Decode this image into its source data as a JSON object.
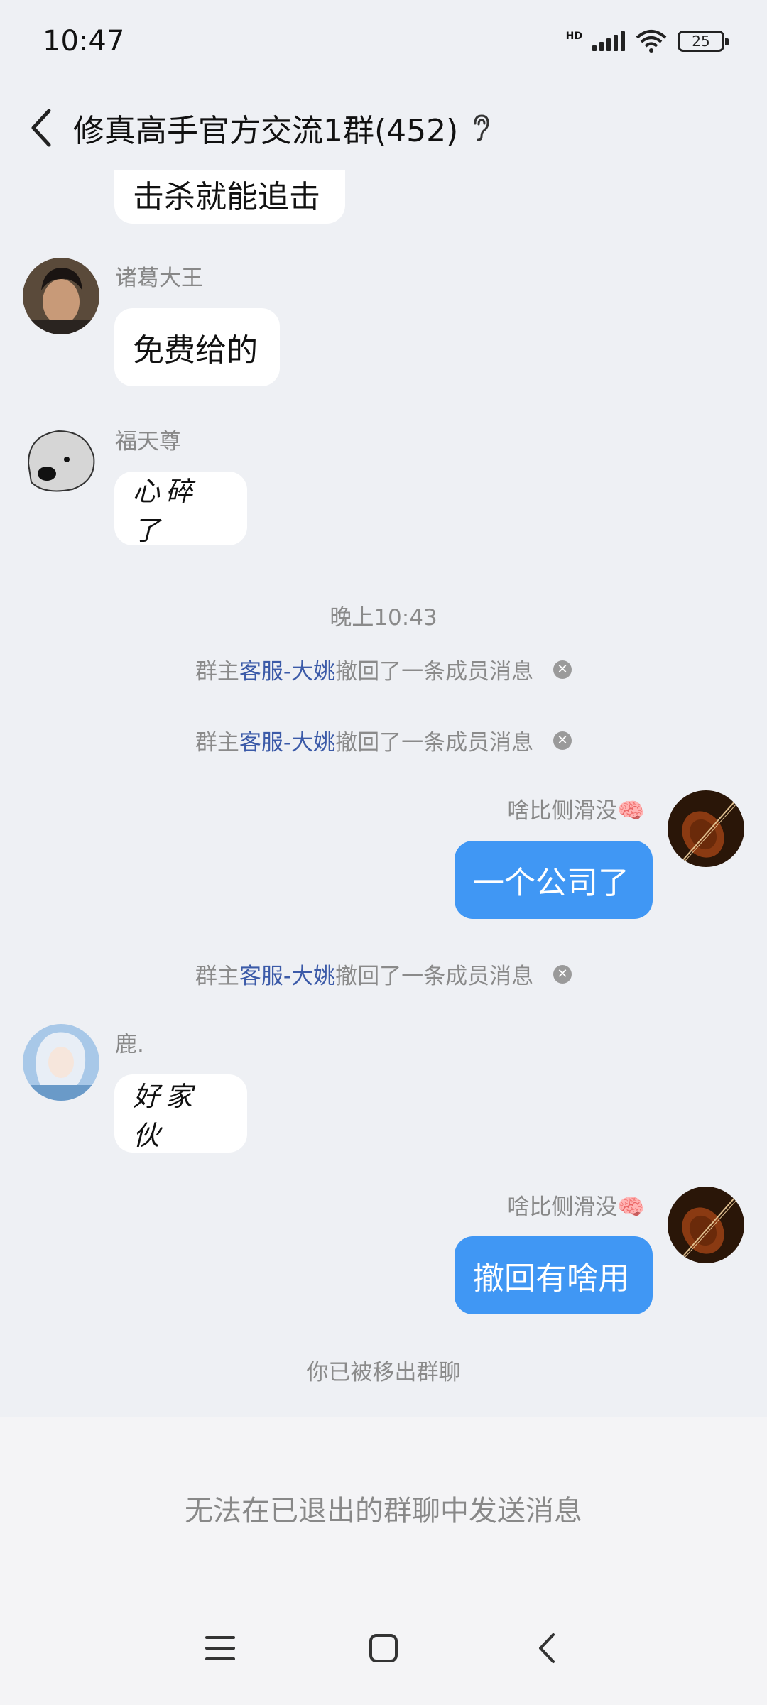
{
  "status": {
    "time": "10:47",
    "hd": "HD",
    "battery": "25"
  },
  "header": {
    "title": "修真高手官方交流1群(452)"
  },
  "messages": {
    "partial_text": "击杀就能追击",
    "m1": {
      "sender": "诸葛大王",
      "text": "免费给的"
    },
    "m2": {
      "sender": "福天尊",
      "text": "心碎了"
    },
    "timestamp": "晚上10:43",
    "recall_prefix": "群主",
    "recall_admin": "客服-大姚",
    "recall_suffix": "撤回了一条成员消息",
    "m3": {
      "sender": "啥比侧滑没🧠",
      "text": "一个公司了"
    },
    "m4": {
      "sender": "鹿.",
      "text": "好家伙"
    },
    "m5": {
      "sender": "啥比侧滑没🧠",
      "text": "撤回有啥用"
    },
    "removed_notice": "你已被移出群聊"
  },
  "footer": {
    "blocked_text": "无法在已退出的群聊中发送消息"
  },
  "colors": {
    "self_bubble": "#4097f4",
    "admin_link": "#3b5aa8",
    "background": "#eef0f4"
  }
}
